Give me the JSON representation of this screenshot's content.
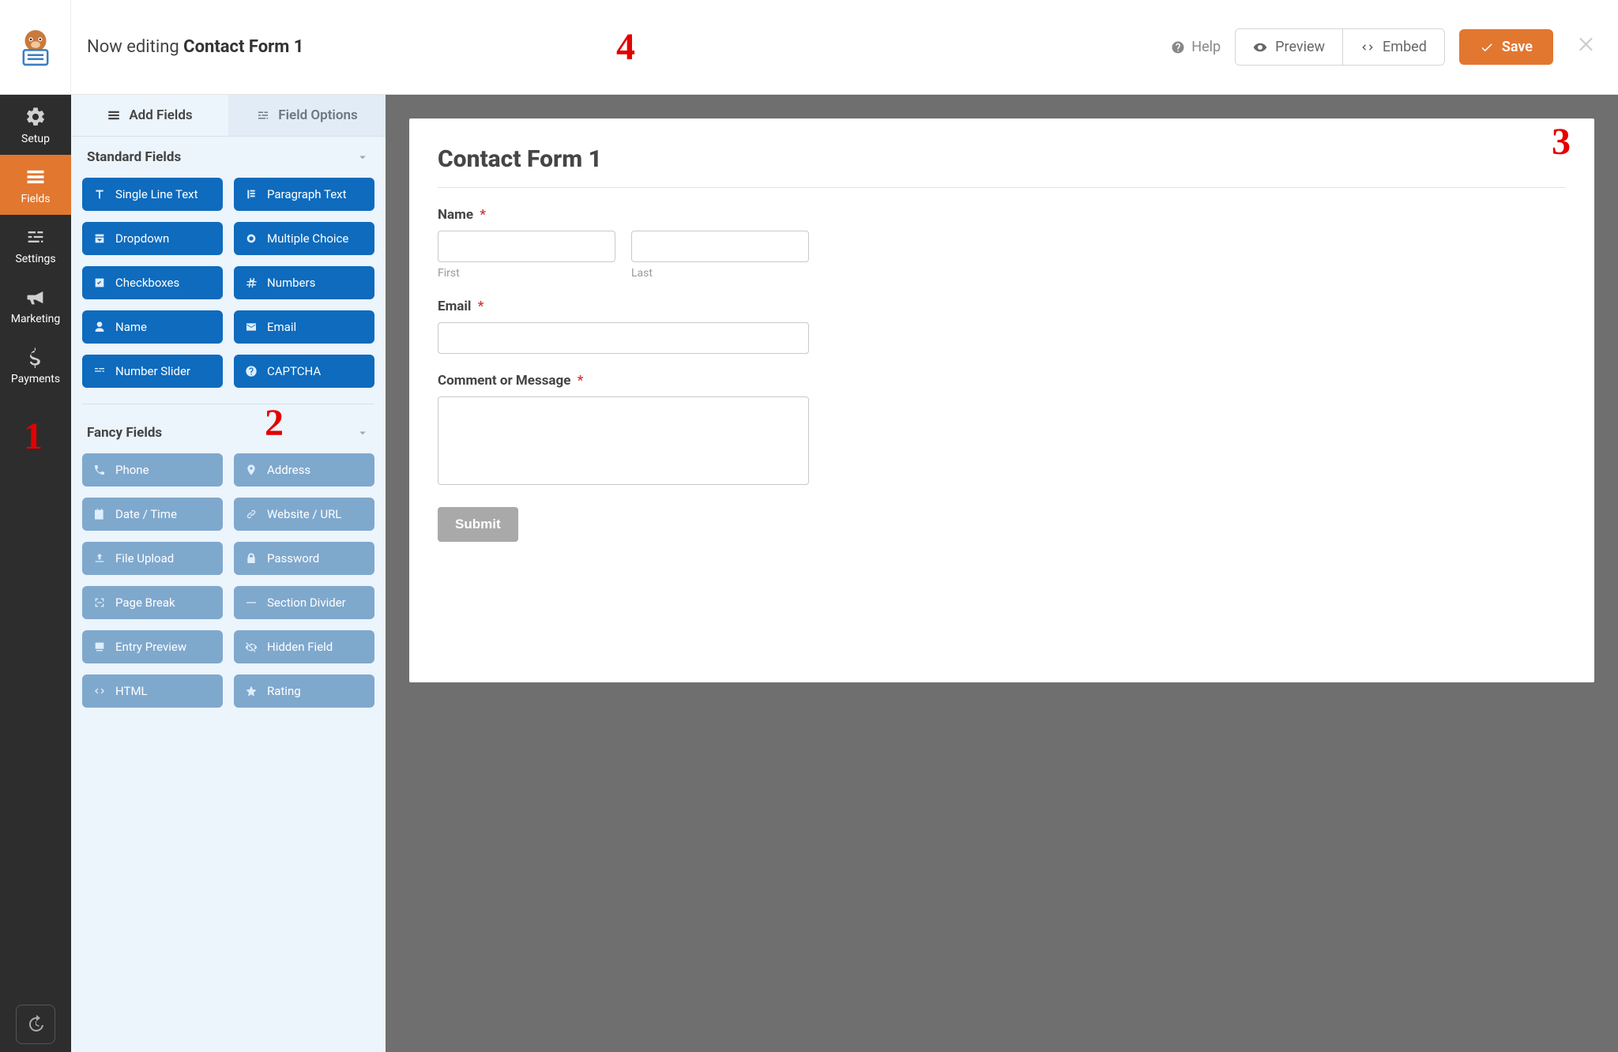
{
  "annotations": {
    "a1": "1",
    "a2": "2",
    "a3": "3",
    "a4": "4"
  },
  "topbar": {
    "editing_prefix": "Now editing ",
    "editing_name": "Contact Form 1",
    "help": "Help",
    "preview": "Preview",
    "embed": "Embed",
    "save": "Save"
  },
  "leftnav": {
    "setup": "Setup",
    "fields": "Fields",
    "settings": "Settings",
    "marketing": "Marketing",
    "payments": "Payments"
  },
  "tabs": {
    "add": "Add Fields",
    "options": "Field Options"
  },
  "sections": {
    "standard": "Standard Fields",
    "fancy": "Fancy Fields"
  },
  "standard_fields": {
    "single_line_text": "Single Line Text",
    "paragraph_text": "Paragraph Text",
    "dropdown": "Dropdown",
    "multiple_choice": "Multiple Choice",
    "checkboxes": "Checkboxes",
    "numbers": "Numbers",
    "name": "Name",
    "email": "Email",
    "number_slider": "Number Slider",
    "captcha": "CAPTCHA"
  },
  "fancy_fields": {
    "phone": "Phone",
    "address": "Address",
    "date_time": "Date / Time",
    "website_url": "Website / URL",
    "file_upload": "File Upload",
    "password": "Password",
    "page_break": "Page Break",
    "section_divider": "Section Divider",
    "entry_preview": "Entry Preview",
    "hidden_field": "Hidden Field",
    "html": "HTML",
    "rating": "Rating"
  },
  "preview": {
    "title": "Contact Form 1",
    "name_label": "Name",
    "first": "First",
    "last": "Last",
    "email_label": "Email",
    "comment_label": "Comment or Message",
    "submit": "Submit",
    "required_marker": "*"
  }
}
